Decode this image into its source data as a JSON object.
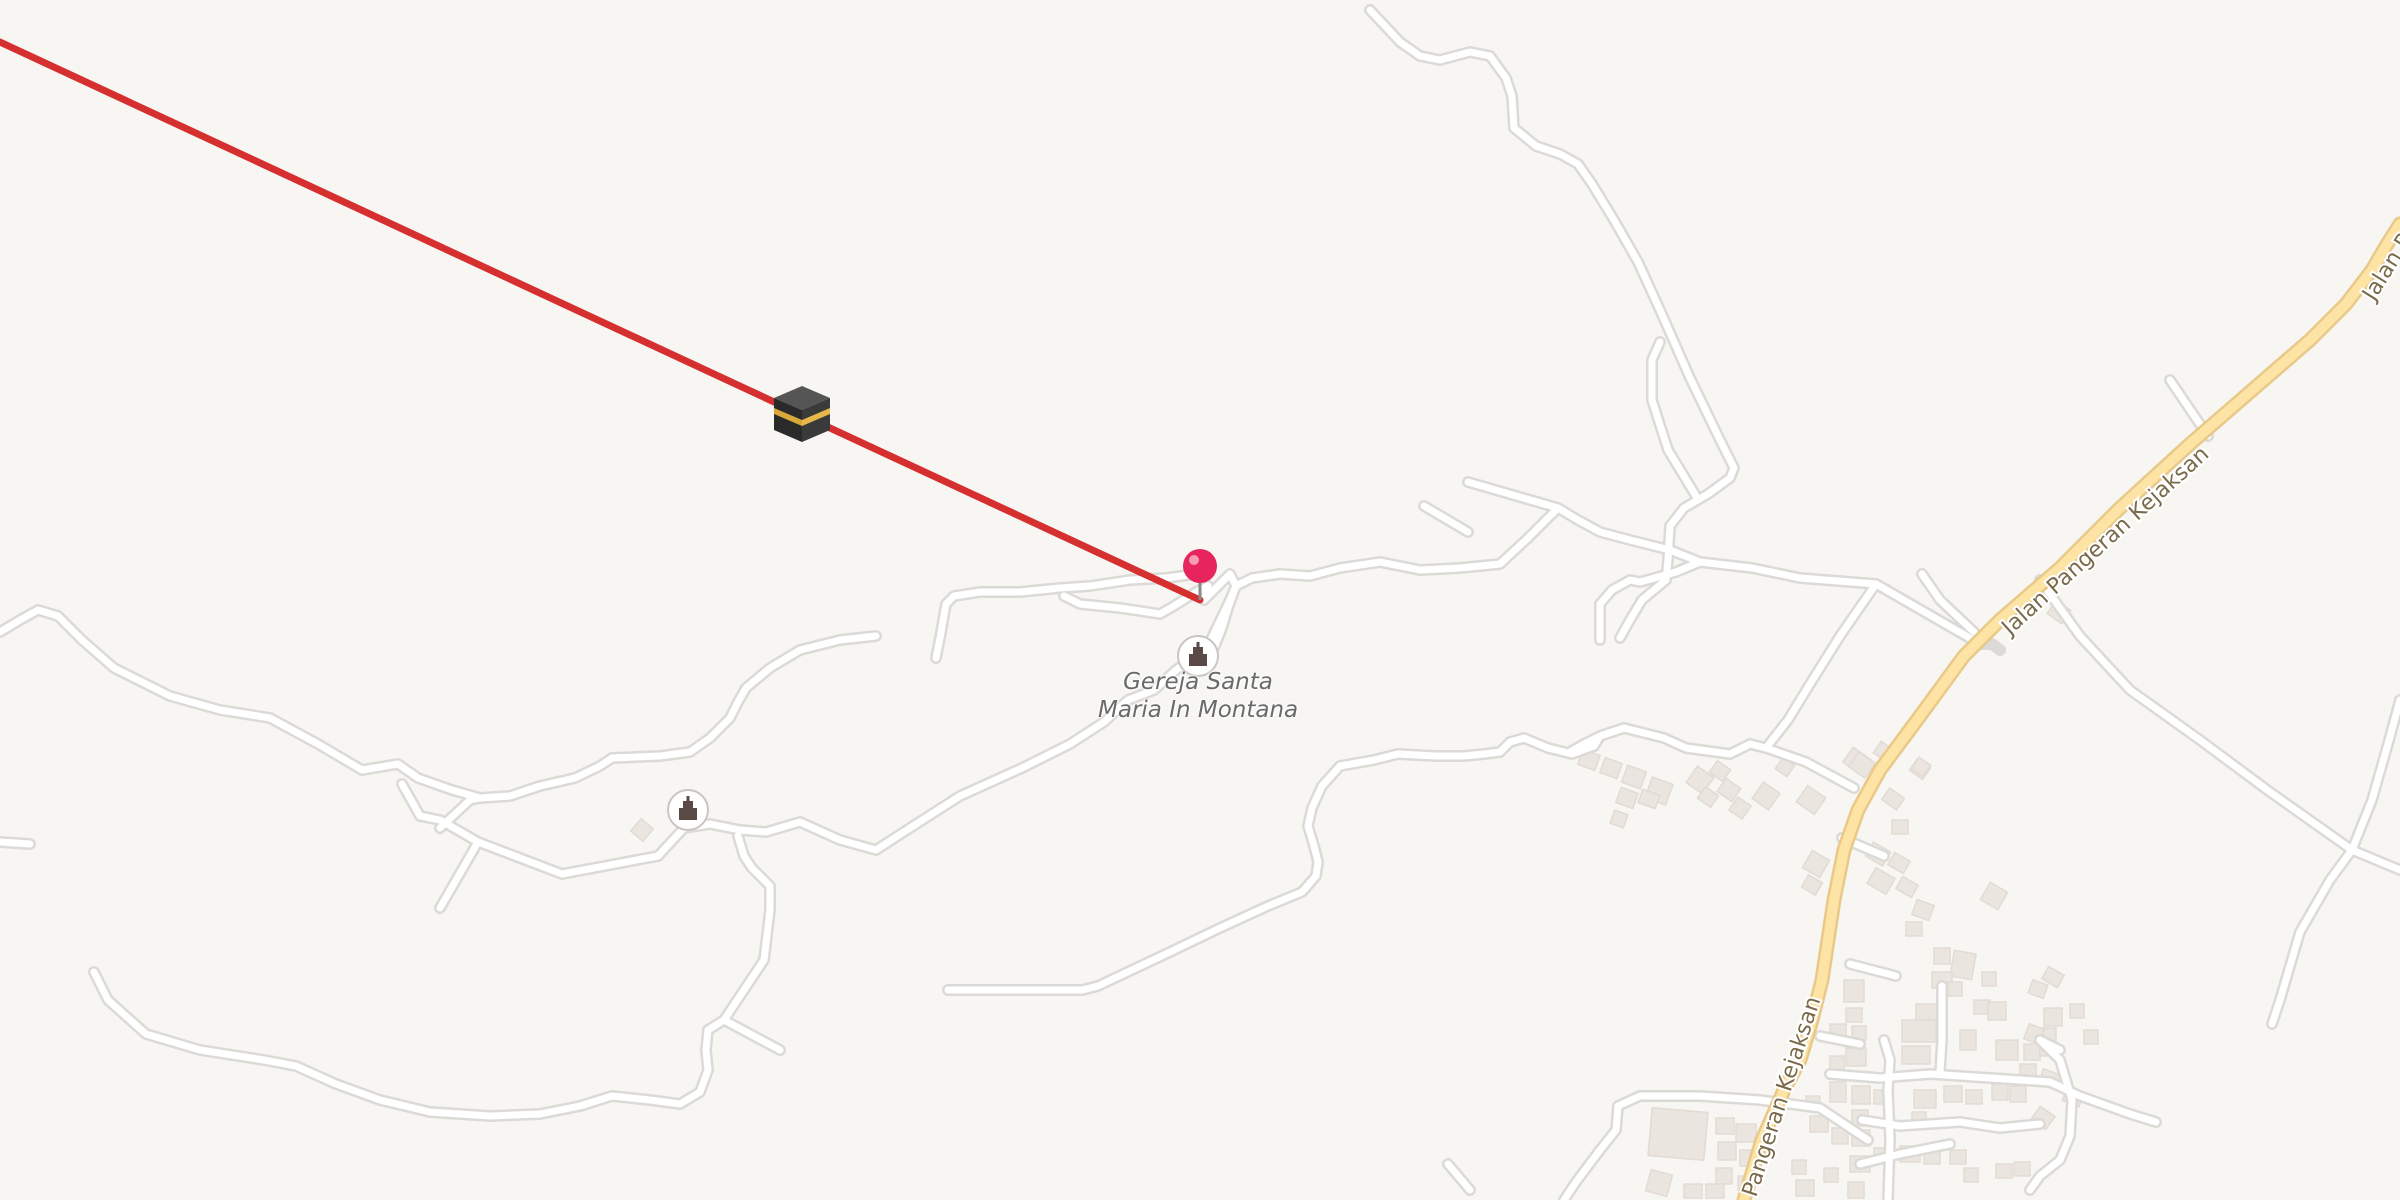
{
  "map": {
    "poi": {
      "church_name_line1": "Gereja Santa",
      "church_name_line2": "Maria In Montana"
    },
    "streets": {
      "main_road_lower": "Pangeran Kejaksan",
      "main_road_middle": "Jalan Pangeran Kejaksan",
      "main_road_upper": "Jalan P"
    },
    "markers": {
      "pin_color": "#e8245c",
      "direction_line_color": "#d62f2f",
      "destination_icon": "kaaba-icon",
      "place_of_worship_icon": "church-icon"
    },
    "colors": {
      "background": "#f8f6f2",
      "road": "#ffffff",
      "main_road": "#fde3a4",
      "building": "#ebe5df"
    }
  }
}
